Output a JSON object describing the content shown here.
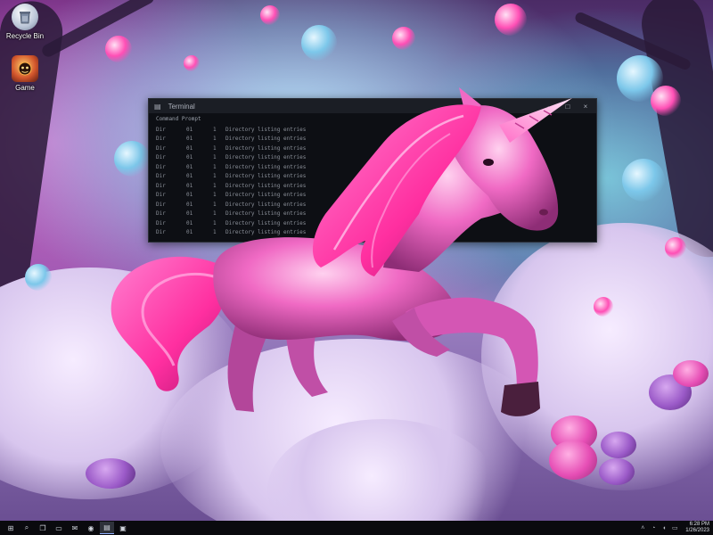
{
  "desktop": {
    "icons": [
      {
        "label": "Recycle Bin",
        "icon": "recycle-bin-icon"
      },
      {
        "label": "Game",
        "icon": "game-icon"
      }
    ]
  },
  "terminal": {
    "title": "Terminal",
    "header": "Command Prompt",
    "rows": [
      {
        "c1": "Dir",
        "c2": "01",
        "c3": "1",
        "c4": "Directory listing entries"
      },
      {
        "c1": "Dir",
        "c2": "01",
        "c3": "1",
        "c4": "Directory listing entries"
      },
      {
        "c1": "Dir",
        "c2": "01",
        "c3": "1",
        "c4": "Directory listing entries"
      },
      {
        "c1": "Dir",
        "c2": "01",
        "c3": "1",
        "c4": "Directory listing entries"
      },
      {
        "c1": "Dir",
        "c2": "01",
        "c3": "1",
        "c4": "Directory listing entries"
      },
      {
        "c1": "Dir",
        "c2": "01",
        "c3": "1",
        "c4": "Directory listing entries"
      },
      {
        "c1": "Dir",
        "c2": "01",
        "c3": "1",
        "c4": "Directory listing entries"
      },
      {
        "c1": "Dir",
        "c2": "01",
        "c3": "1",
        "c4": "Directory listing entries"
      },
      {
        "c1": "Dir",
        "c2": "01",
        "c3": "1",
        "c4": "Directory listing entries"
      },
      {
        "c1": "Dir",
        "c2": "01",
        "c3": "1",
        "c4": "Directory listing entries"
      },
      {
        "c1": "Dir",
        "c2": "01",
        "c3": "1",
        "c4": "Directory listing entries"
      },
      {
        "c1": "Dir",
        "c2": "01",
        "c3": "1",
        "c4": "Directory listing entries"
      }
    ],
    "controls": {
      "minimize": "–",
      "maximize": "□",
      "close": "×"
    }
  },
  "taskbar": {
    "buttons": [
      {
        "icon": "start-icon",
        "glyph": "⊞"
      },
      {
        "icon": "search-icon",
        "glyph": "⌕"
      },
      {
        "icon": "task-view-icon",
        "glyph": "❐"
      },
      {
        "icon": "folder-icon",
        "glyph": "▭"
      },
      {
        "icon": "mail-icon",
        "glyph": "✉"
      },
      {
        "icon": "browser-icon",
        "glyph": "◉"
      },
      {
        "icon": "terminal-icon",
        "glyph": "▤"
      },
      {
        "icon": "store-icon",
        "glyph": "▣"
      }
    ],
    "tray": [
      {
        "icon": "chevron-up-icon",
        "glyph": "˄"
      },
      {
        "icon": "network-icon",
        "glyph": "◔"
      },
      {
        "icon": "volume-icon",
        "glyph": "◖"
      },
      {
        "icon": "battery-icon",
        "glyph": "▭"
      }
    ],
    "clock": {
      "time": "6:28 PM",
      "date": "1/26/2023"
    }
  },
  "colors": {
    "accent": "#ff4fb5",
    "unicorn_body": "#f06ac4",
    "unicorn_mane": "#ff3fa8"
  }
}
